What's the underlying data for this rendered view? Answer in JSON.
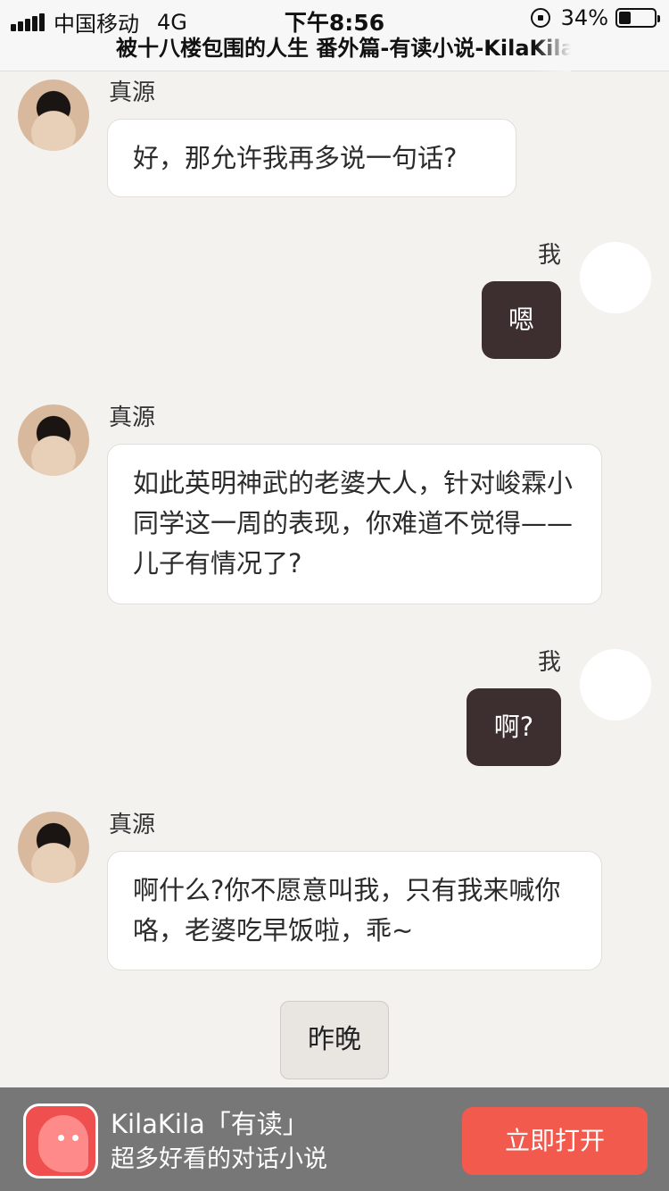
{
  "status_bar": {
    "carrier": "中国移动",
    "network": "4G",
    "time": "下午8:56",
    "battery": "34%",
    "battery_level": 0.34
  },
  "page_title": "被十八楼包围的人生 番外篇-有读小说-KilaKila",
  "messages": [
    {
      "side": "left",
      "name": "真源",
      "text": "好，那允许我再多说一句话?"
    },
    {
      "side": "right",
      "name": "我",
      "text": "嗯"
    },
    {
      "side": "left",
      "name": "真源",
      "text": "如此英明神武的老婆大人，针对峻霖小同学这一周的表现，你难道不觉得——儿子有情况了?"
    },
    {
      "side": "right",
      "name": "我",
      "text": "啊?"
    },
    {
      "side": "left",
      "name": "真源",
      "text": "啊什么?你不愿意叫我，只有我来喊你咯，老婆吃早饭啦，乖~"
    }
  ],
  "time_separator": "昨晚",
  "banner": {
    "title": "KilaKila「有读」",
    "subtitle": "超多好看的对话小说",
    "button": "立即打开"
  }
}
